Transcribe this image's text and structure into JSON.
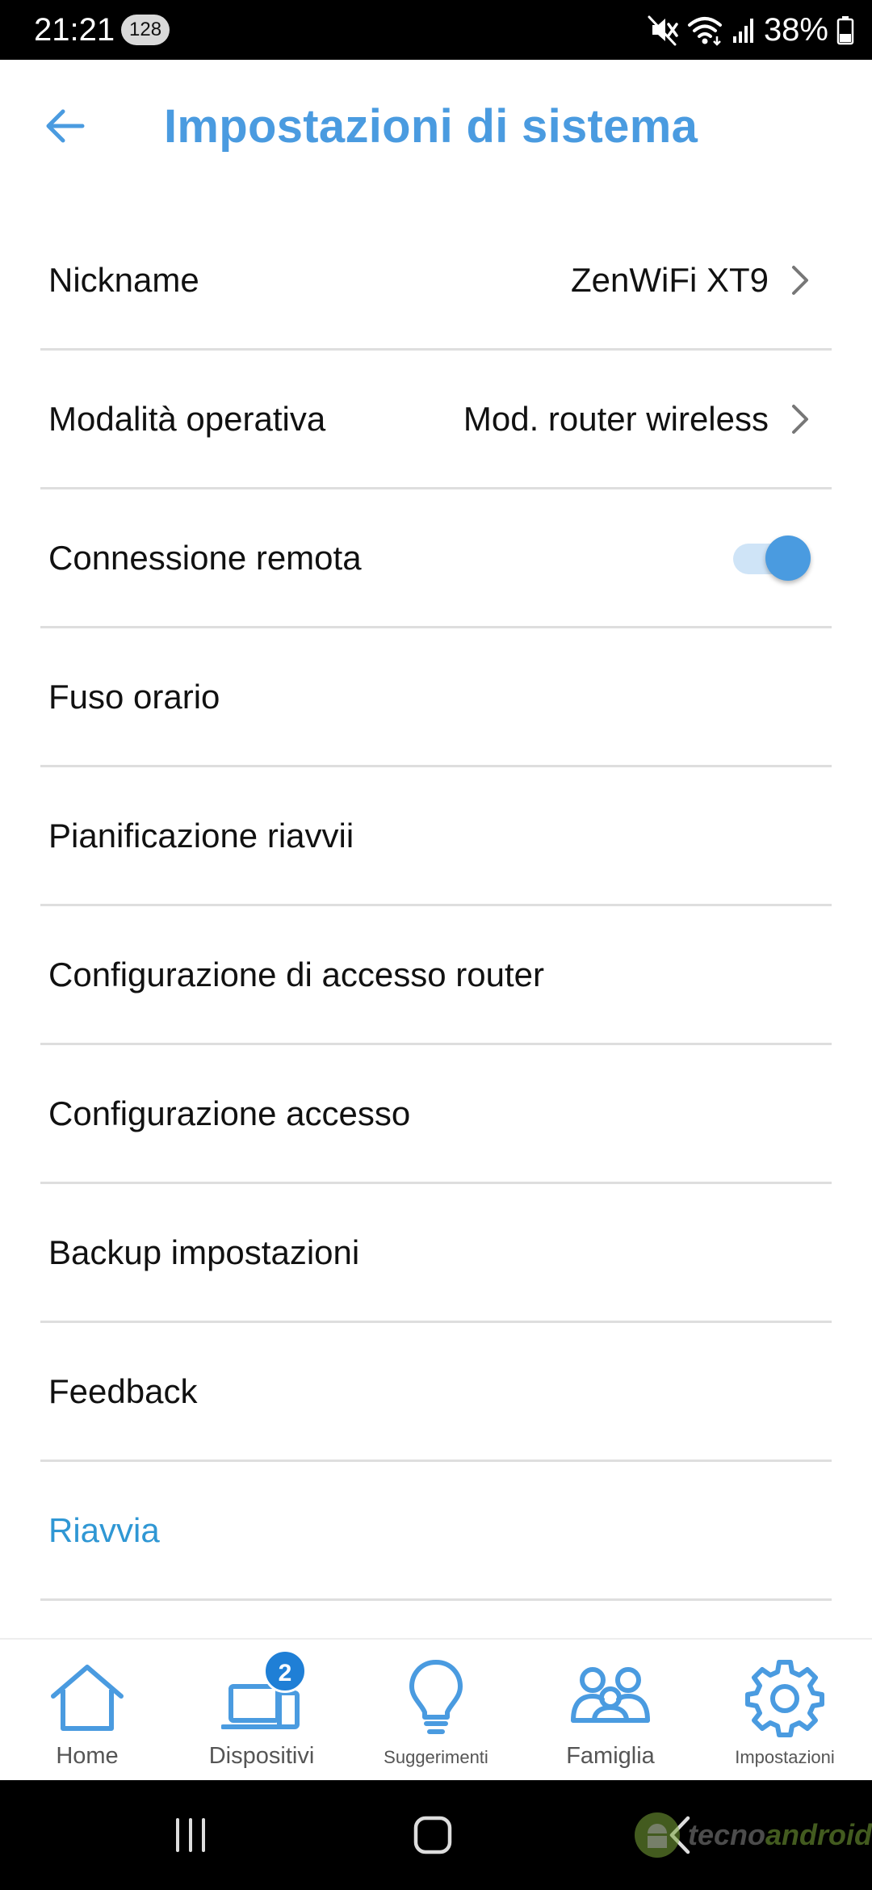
{
  "status_bar": {
    "time": "21:21",
    "notification_badge": "128",
    "battery": "38%",
    "icons": [
      "mute-icon",
      "wifi-icon",
      "signal-icon",
      "battery-icon"
    ]
  },
  "header": {
    "title": "Impostazioni di sistema",
    "back_icon": "back-arrow-icon"
  },
  "settings": {
    "nickname": {
      "label": "Nickname",
      "value": "ZenWiFi XT9"
    },
    "operating_mode": {
      "label": "Modalità operativa",
      "value": "Mod. router wireless"
    },
    "remote_connection": {
      "label": "Connessione remota",
      "enabled": true
    },
    "timezone": {
      "label": "Fuso orario"
    },
    "reboot_schedule": {
      "label": "Pianificazione riavvii"
    },
    "router_access_config": {
      "label": "Configurazione di accesso router"
    },
    "access_config": {
      "label": "Configurazione accesso"
    },
    "backup": {
      "label": "Backup impostazioni"
    },
    "feedback": {
      "label": "Feedback"
    },
    "reboot": {
      "label": "Riavvia"
    }
  },
  "bottom_nav": {
    "items": [
      {
        "label": "Home",
        "icon": "home-icon"
      },
      {
        "label": "Dispositivi",
        "icon": "devices-icon",
        "badge": "2"
      },
      {
        "label": "Suggerimenti",
        "icon": "lightbulb-icon"
      },
      {
        "label": "Famiglia",
        "icon": "family-icon"
      },
      {
        "label": "Impostazioni",
        "icon": "gear-icon",
        "active": true
      }
    ]
  },
  "watermark": {
    "part1": "tecno",
    "part2": "android"
  },
  "colors": {
    "accent": "#4a9be0",
    "link": "#2f97d4",
    "badge": "#1f7fd6",
    "toggle_track": "#cfe4f7",
    "divider": "#dedede"
  }
}
